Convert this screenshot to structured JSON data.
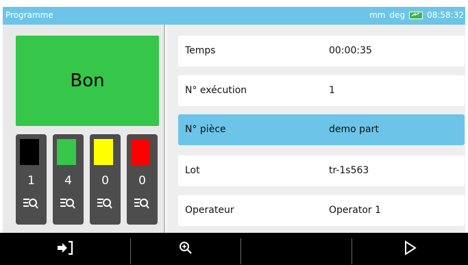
{
  "titlebar": {
    "title": "Programme",
    "unit_length": "mm",
    "unit_angle": "deg",
    "time": "08:58:32",
    "battery_icon": "battery-charging-icon"
  },
  "verdict": {
    "label": "Bon",
    "color": "#35c64a"
  },
  "counters": [
    {
      "color": "#000000",
      "count": "1"
    },
    {
      "color": "#35c64a",
      "count": "4"
    },
    {
      "color": "#ffff00",
      "count": "0"
    },
    {
      "color": "#ff0000",
      "count": "0"
    }
  ],
  "info_rows": [
    {
      "label": "Temps",
      "value": "00:00:35"
    },
    {
      "label": "N° exécution",
      "value": "1"
    },
    {
      "label": "N° pièce",
      "value": "demo part"
    },
    {
      "label": "Lot",
      "value": "tr-1s563"
    },
    {
      "label": "Operateur",
      "value": "Operator 1"
    }
  ],
  "selected_row": 2,
  "toolbar": {
    "buttons": [
      "exit-icon",
      "zoom-in-icon",
      "play-icon"
    ]
  },
  "colors": {
    "accent": "#6cc5e8",
    "toolbar": "#000000",
    "counter_bg": "#4d4d4d"
  }
}
